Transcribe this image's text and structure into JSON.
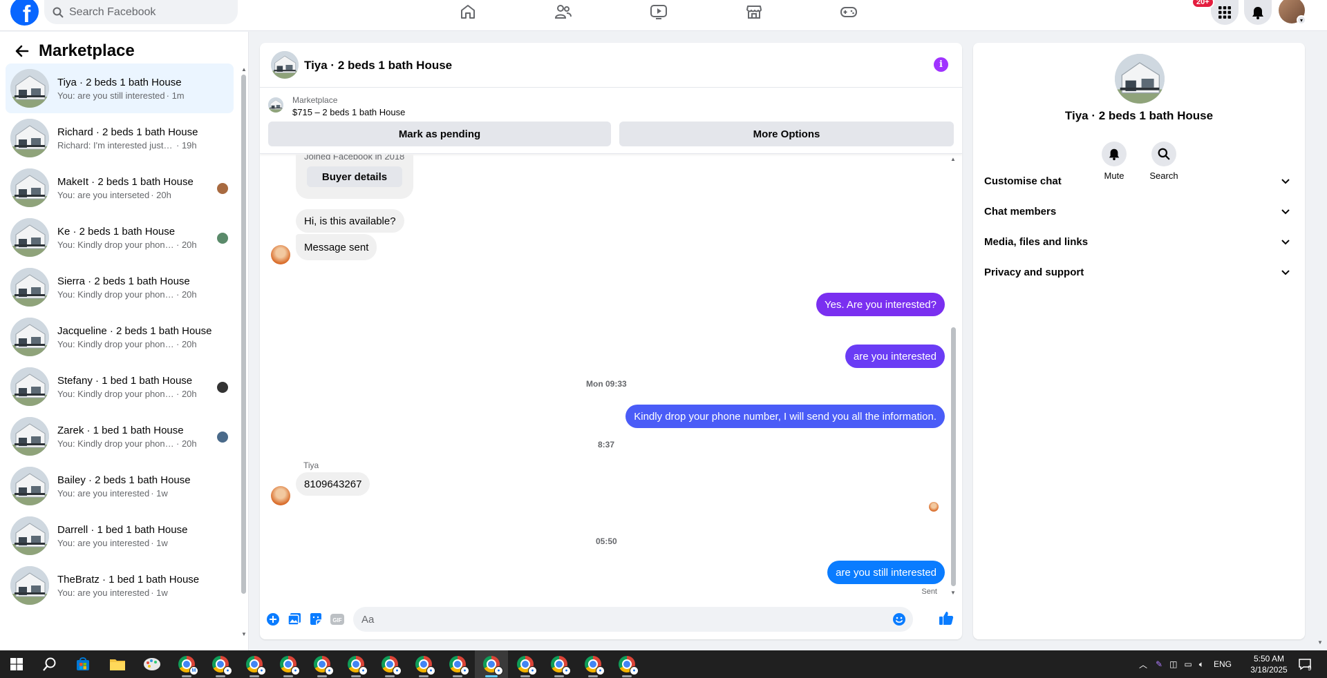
{
  "topbar": {
    "logo_letter": "f",
    "search_placeholder": "Search Facebook",
    "nav_icons": [
      "home-icon",
      "friends-icon",
      "video-icon",
      "marketplace-icon",
      "gaming-icon"
    ],
    "notification_badge": "20+",
    "brand_color": "#0866ff"
  },
  "left_panel": {
    "title": "Marketplace",
    "conversations": [
      {
        "name": "Tiya · 2 beds 1 bath House",
        "preview": "You: are you still interested",
        "time": "· 1m",
        "active": true
      },
      {
        "name": "Richard · 2 beds 1 bath House",
        "preview": "Richard: I'm interested just need t...",
        "time": "· 19h"
      },
      {
        "name": "MakeIt · 2 beds 1 bath House",
        "preview": "You: are you interseted",
        "time": "· 20h"
      },
      {
        "name": "Ke · 2 beds 1 bath House",
        "preview": "You: Kindly drop your phone n...",
        "time": "· 20h"
      },
      {
        "name": "Sierra · 2 beds 1 bath House",
        "preview": "You: Kindly drop your phone num...",
        "time": "· 20h"
      },
      {
        "name": "Jacqueline · 2 beds 1 bath House",
        "preview": "You: Kindly drop your phone num...",
        "time": "· 20h"
      },
      {
        "name": "Stefany · 1 bed 1 bath House",
        "preview": "You: Kindly drop your phone n...",
        "time": "· 20h"
      },
      {
        "name": "Zarek · 1 bed 1 bath House",
        "preview": "You: Kindly drop your phone n...",
        "time": "· 20h"
      },
      {
        "name": "Bailey · 2 beds 1 bath House",
        "preview": "You: are you interested",
        "time": "· 1w"
      },
      {
        "name": "Darrell · 1 bed 1 bath House",
        "preview": "You: are you interested",
        "time": "· 1w"
      },
      {
        "name": "TheBratz · 1 bed 1 bath House",
        "preview": "You: are you interested",
        "time": "· 1w"
      }
    ]
  },
  "chat": {
    "title": "Tiya · 2 beds 1 bath House",
    "info_glyph": "i",
    "listing_label": "Marketplace",
    "listing_price": "$715 – 2 beds 1 bath House",
    "mark_pending_label": "Mark as pending",
    "more_options_label": "More Options",
    "buyer_joined": "Joined Facebook in 2018",
    "buyer_details_label": "Buyer details",
    "messages": {
      "m1": "Hi, is this available?",
      "m2": "Message sent",
      "m3": "Yes. Are you interested?",
      "m4": "are you interested",
      "t1": "Mon 09:33",
      "m5": "Kindly drop your phone number, I will send you all the information.",
      "t2": "8:37",
      "sender": "Tiya",
      "m6": "8109643267",
      "t3": "05:50",
      "m7": "are you still interested",
      "status": "Sent"
    },
    "composer_placeholder": "Aa",
    "outgoing_colors": [
      "#7a2ff0",
      "#6a3cf5",
      "#4a5cf7",
      "#0a7cff"
    ]
  },
  "right_panel": {
    "name": "Tiya · 2 beds 1 bath House",
    "mute_label": "Mute",
    "search_label": "Search",
    "sections": [
      "Customise chat",
      "Chat members",
      "Media, files and links",
      "Privacy and support"
    ]
  },
  "taskbar": {
    "time": "5:50 AM",
    "date": "3/18/2025",
    "language": "ENG",
    "notification_count": "9"
  }
}
